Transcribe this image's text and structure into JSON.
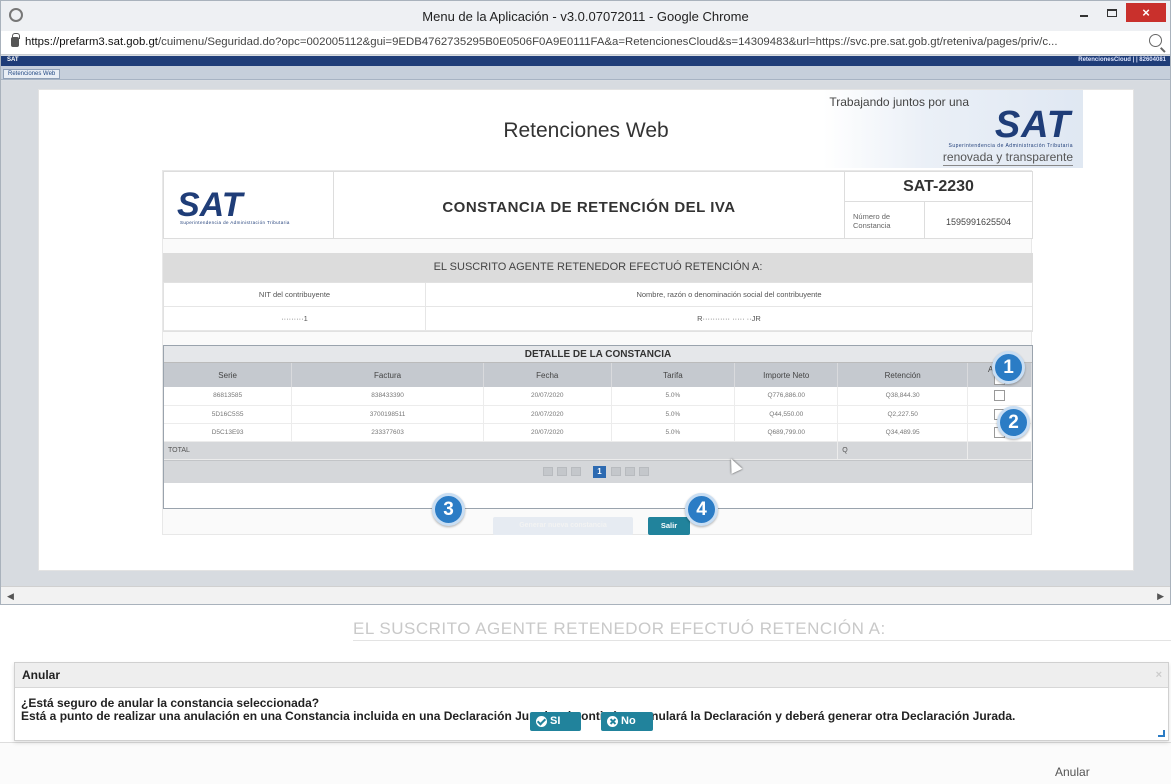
{
  "browser": {
    "title": "Menu de la Aplicación - v3.0.07072011 - Google Chrome",
    "url_host": "https://prefarm3.sat.gob.gt",
    "url_path": "/cuimenu/Seguridad.do?opc=002005112&gui=9EDB4762735295B0E0506F0A9E0111FA&a=RetencionesCloud&s=14309483&url=https://svc.pre.sat.gob.gt/reteniva/pages/priv/c...",
    "close_glyph": "×"
  },
  "site": {
    "bar_left": "SAT",
    "bar_right": "RetencionesCloud | | 82604081",
    "tab": "Retenciones Web"
  },
  "banner": {
    "heading": "Retenciones Web",
    "tagline_top": "Trabajando juntos por una",
    "logo": "SAT",
    "logo_sub": "Superintendencia de Administración Tributaria",
    "tagline_bottom": "renovada y transparente"
  },
  "document": {
    "logo": "SAT",
    "logo_sub": "Superintendencia de Administración Tributaria",
    "title": "CONSTANCIA DE RETENCIÓN DEL IVA",
    "code": "SAT-2230",
    "number_label": "Número de Constancia",
    "number_value": "1595991625504",
    "suscrito": "EL SUSCRITO AGENTE RETENEDOR EFECTUÓ RETENCIÓN A:",
    "nit_label": "NIT del contribuyente",
    "name_label": "Nombre, razón o denominación social del contribuyente",
    "nit_value": "·········1",
    "name_value": "R··········· ····· ··JR"
  },
  "detalle": {
    "title": "DETALLE DE LA CONSTANCIA",
    "columns": [
      "Serie",
      "Factura",
      "Fecha",
      "Tarifa",
      "Importe Neto",
      "Retención",
      "Anular"
    ],
    "rows": [
      {
        "serie": "86813585",
        "factura": "838433390",
        "fecha": "20/07/2020",
        "tarifa": "5.0%",
        "importe": "Q776,886.00",
        "retencion": "Q38,844.30"
      },
      {
        "serie": "5D16C5S5",
        "factura": "3700198511",
        "fecha": "20/07/2020",
        "tarifa": "5.0%",
        "importe": "Q44,550.00",
        "retencion": "Q2,227.50"
      },
      {
        "serie": "D5C13E93",
        "factura": "233377603",
        "fecha": "20/07/2020",
        "tarifa": "5.0%",
        "importe": "Q689,799.00",
        "retencion": "Q34,489.95"
      }
    ],
    "total_label": "TOTAL",
    "total_currency": "Q",
    "current_page": "1"
  },
  "actions": {
    "generate_label": "Generar nueva constancia",
    "exit_label": "Salir"
  },
  "badges": [
    "1",
    "2",
    "3",
    "4"
  ],
  "dialog": {
    "bg_text": "EL SUSCRITO AGENTE RETENEDOR EFECTUÓ RETENCIÓN A:",
    "title": "Anular",
    "question": "¿Está seguro de anular la constancia seleccionada?",
    "warning": "Está a punto de realizar una anulación en una Constancia incluida en una Declaración Jurada, si continúa se anulará la Declaración y deberá generar otra Declaración Jurada.",
    "yes_label": "SI",
    "no_label": "No",
    "close_glyph": "×",
    "bg_anular": "Anular"
  },
  "colors": {
    "sat_blue": "#1f3d78",
    "teal_button": "#21839c",
    "badge_blue": "#2b7cc5",
    "close_red": "#c9302c"
  }
}
